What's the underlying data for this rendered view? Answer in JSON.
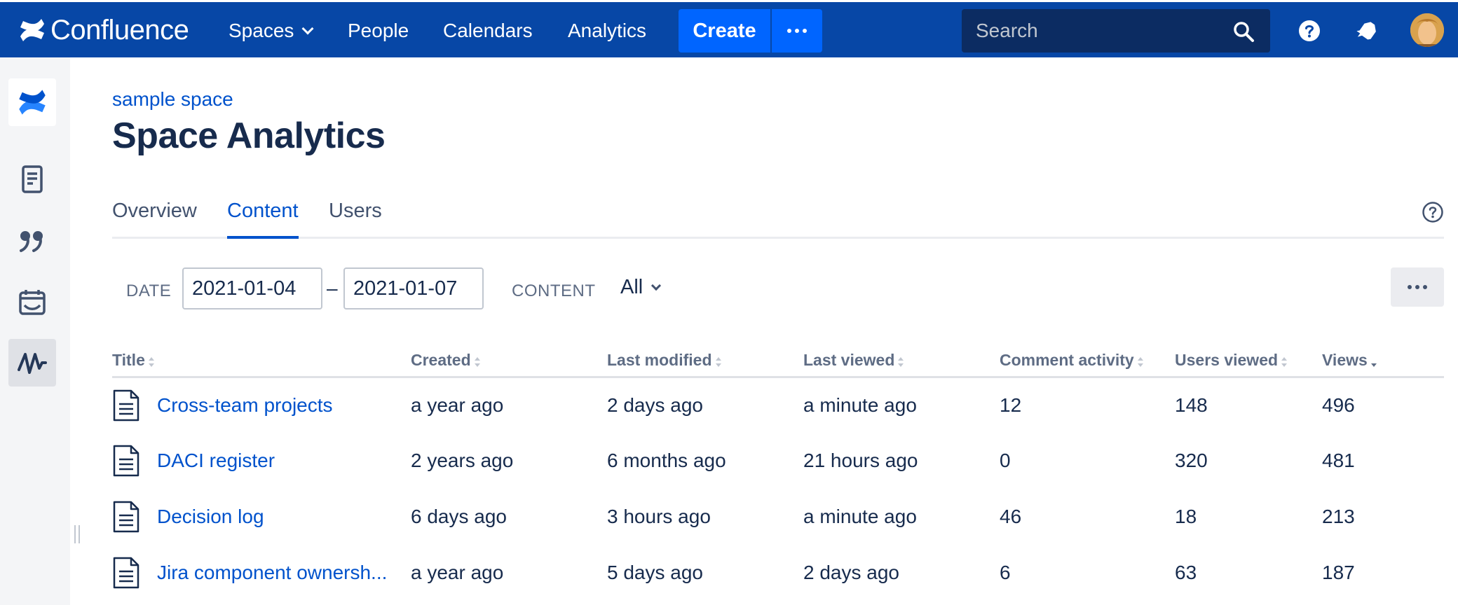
{
  "topnav": {
    "logo_text": "Confluence",
    "spaces": "Spaces",
    "people": "People",
    "calendars": "Calendars",
    "analytics": "Analytics",
    "create": "Create",
    "search_placeholder": "Search",
    "brand_color": "#0747a6",
    "create_color": "#0065ff"
  },
  "sidebar": {
    "items": [
      "confluence-logo-icon",
      "pages-icon",
      "blog-quote-icon",
      "calendar-icon",
      "analytics-icon"
    ]
  },
  "main": {
    "breadcrumb": "sample space",
    "title": "Space Analytics",
    "tabs": [
      {
        "label": "Overview",
        "active": false
      },
      {
        "label": "Content",
        "active": true
      },
      {
        "label": "Users",
        "active": false
      }
    ],
    "filters": {
      "date_label": "DATE",
      "date_from": "2021-01-04",
      "date_sep": "–",
      "date_to": "2021-01-07",
      "content_label": "CONTENT",
      "content_value": "All"
    },
    "table": {
      "columns": [
        "Title",
        "Created",
        "Last modified",
        "Last viewed",
        "Comment activity",
        "Users viewed",
        "Views"
      ],
      "sorted_column": "Views",
      "rows": [
        {
          "title": "Cross-team projects",
          "created": "a year ago",
          "modified": "2 days ago",
          "viewed": "a minute ago",
          "comments": "12",
          "users": "148",
          "views": "496"
        },
        {
          "title": "DACI register",
          "created": "2 years ago",
          "modified": "6 months ago",
          "viewed": "21 hours ago",
          "comments": "0",
          "users": "320",
          "views": "481"
        },
        {
          "title": "Decision log",
          "created": "6 days ago",
          "modified": "3 hours ago",
          "viewed": "a minute ago",
          "comments": "46",
          "users": "18",
          "views": "213"
        },
        {
          "title": "Jira component ownersh...",
          "created": "a year ago",
          "modified": "5 days ago",
          "viewed": "2 days ago",
          "comments": "6",
          "users": "63",
          "views": "187"
        }
      ]
    }
  }
}
